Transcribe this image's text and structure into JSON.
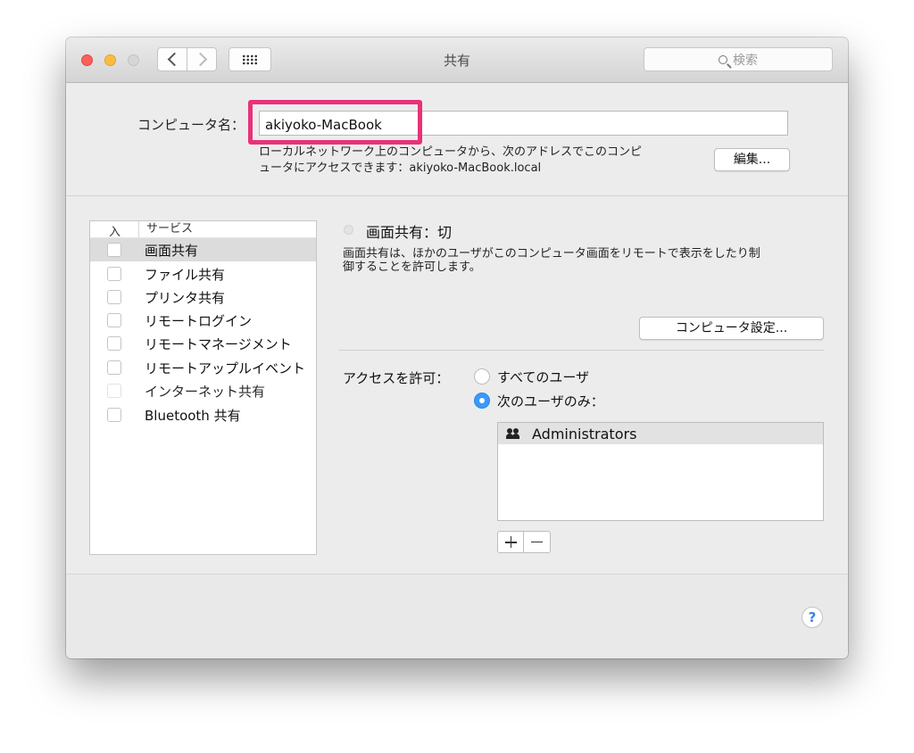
{
  "window": {
    "title": "共有"
  },
  "search": {
    "placeholder": "検索"
  },
  "computer_name": {
    "label": "コンピュータ名：",
    "value": "akiyoko-MacBook",
    "address_note_line1": "ローカルネットワーク上のコンピュータから、次のアドレスでこのコンピ",
    "address_note_line2": "ュータにアクセスできます：akiyoko-MacBook.local",
    "edit_label": "編集..."
  },
  "services": {
    "header_on": "入",
    "header_service": "サービス",
    "items": [
      {
        "label": "画面共有",
        "checked": false,
        "selected": true
      },
      {
        "label": "ファイル共有",
        "checked": false,
        "selected": false
      },
      {
        "label": "プリンタ共有",
        "checked": false,
        "selected": false
      },
      {
        "label": "リモートログイン",
        "checked": false,
        "selected": false
      },
      {
        "label": "リモートマネージメント",
        "checked": false,
        "selected": false
      },
      {
        "label": "リモートアップルイベント",
        "checked": false,
        "selected": false
      },
      {
        "label": "インターネット共有",
        "checked": false,
        "selected": false,
        "disabled": true
      },
      {
        "label": "Bluetooth 共有",
        "checked": false,
        "selected": false
      }
    ]
  },
  "detail": {
    "status": "画面共有：切",
    "description_line1": "画面共有は、ほかのユーザがこのコンピュータ画面をリモートで表示をしたり制",
    "description_line2": "御することを許可します。",
    "computer_settings_label": "コンピュータ設定...",
    "access_label": "アクセスを許可：",
    "radio_all": "すべてのユーザ",
    "radio_only": "次のユーザのみ：",
    "selected_option": "only",
    "users": [
      "Administrators"
    ]
  },
  "help": {
    "label": "?"
  },
  "colors": {
    "accent": "#3b99fc",
    "highlight": "#e8327a"
  }
}
